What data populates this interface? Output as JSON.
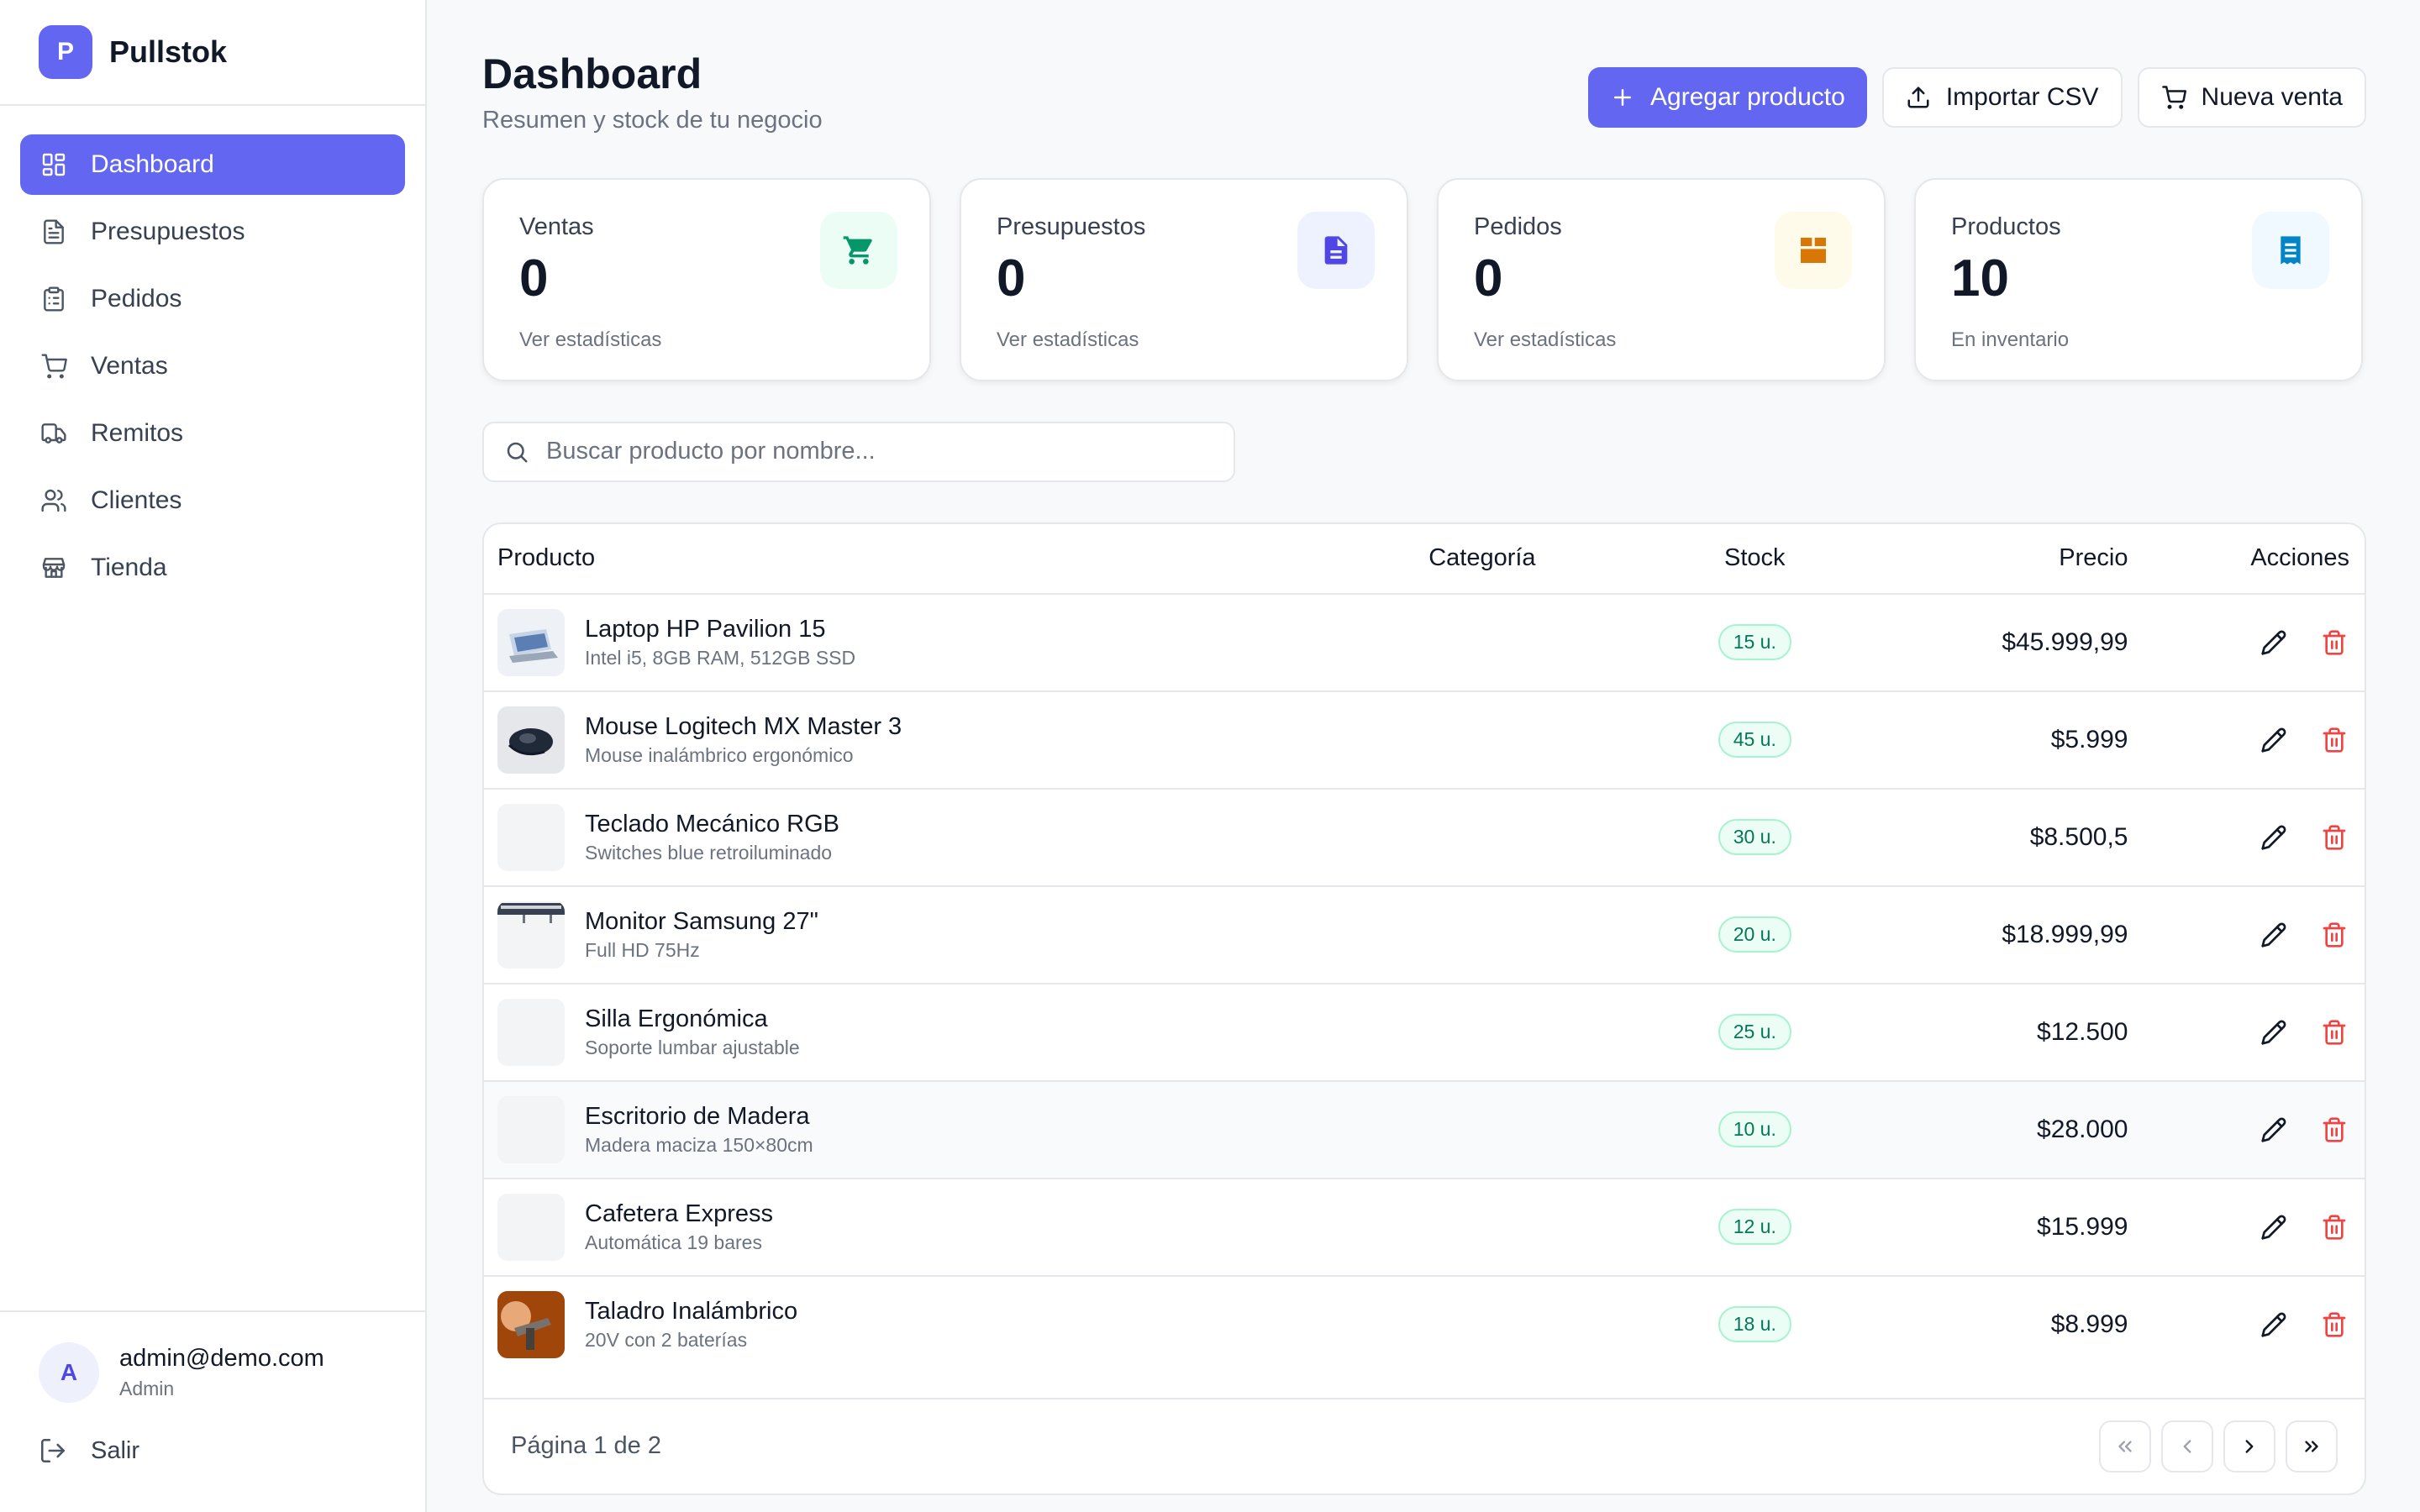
{
  "brand": {
    "logo_letter": "P",
    "name": "Pullstok",
    "accent": "#6366f1"
  },
  "sidebar": {
    "items": [
      {
        "label": "Dashboard",
        "icon": "dashboard-grid-icon",
        "active": true
      },
      {
        "label": "Presupuestos",
        "icon": "document-icon"
      },
      {
        "label": "Pedidos",
        "icon": "clipboard-icon"
      },
      {
        "label": "Ventas",
        "icon": "cart-icon"
      },
      {
        "label": "Remitos",
        "icon": "truck-icon"
      },
      {
        "label": "Clientes",
        "icon": "users-icon"
      },
      {
        "label": "Tienda",
        "icon": "store-icon"
      }
    ],
    "user": {
      "initial": "A",
      "email": "admin@demo.com",
      "role": "Admin"
    },
    "logout_label": "Salir"
  },
  "header": {
    "title": "Dashboard",
    "subtitle": "Resumen y stock de tu negocio",
    "buttons": {
      "add": "Agregar producto",
      "import": "Importar CSV",
      "sale": "Nueva venta"
    }
  },
  "stats": [
    {
      "label": "Ventas",
      "value": "0",
      "sub": "Ver estadísticas",
      "icon": "cart-icon",
      "color": "#059669",
      "bg": "#ecfdf5"
    },
    {
      "label": "Presupuestos",
      "value": "0",
      "sub": "Ver estadísticas",
      "icon": "document-icon",
      "color": "#4f46e5",
      "bg": "#eef2ff"
    },
    {
      "label": "Pedidos",
      "value": "0",
      "sub": "Ver estadísticas",
      "icon": "box-icon",
      "color": "#d97706",
      "bg": "#fffbeb"
    },
    {
      "label": "Productos",
      "value": "10",
      "sub": "En inventario",
      "icon": "receipt-icon",
      "color": "#0284c7",
      "bg": "#f0f9ff"
    }
  ],
  "search": {
    "placeholder": "Buscar producto por nombre..."
  },
  "table": {
    "headers": {
      "product": "Producto",
      "category": "Categoría",
      "stock": "Stock",
      "price": "Precio",
      "actions": "Acciones"
    },
    "rows": [
      {
        "name": "Laptop HP Pavilion 15",
        "desc": "Intel i5, 8GB RAM, 512GB SSD",
        "category": "",
        "stock": "15 u.",
        "price": "$45.999,99",
        "thumb": "laptop"
      },
      {
        "name": "Mouse Logitech MX Master 3",
        "desc": "Mouse inalámbrico ergonómico",
        "category": "",
        "stock": "45 u.",
        "price": "$5.999",
        "thumb": "mouse"
      },
      {
        "name": "Teclado Mecánico RGB",
        "desc": "Switches blue retroiluminado",
        "category": "",
        "stock": "30 u.",
        "price": "$8.500,5",
        "thumb": "none"
      },
      {
        "name": "Monitor Samsung 27\"",
        "desc": "Full HD 75Hz",
        "category": "",
        "stock": "20 u.",
        "price": "$18.999,99",
        "thumb": "monitor"
      },
      {
        "name": "Silla Ergonómica",
        "desc": "Soporte lumbar ajustable",
        "category": "",
        "stock": "25 u.",
        "price": "$12.500",
        "thumb": "none"
      },
      {
        "name": "Escritorio de Madera",
        "desc": "Madera maciza 150×80cm",
        "category": "",
        "stock": "10 u.",
        "price": "$28.000",
        "thumb": "none"
      },
      {
        "name": "Cafetera Express",
        "desc": "Automática 19 bares",
        "category": "",
        "stock": "12 u.",
        "price": "$15.999",
        "thumb": "none"
      },
      {
        "name": "Taladro Inalámbrico",
        "desc": "20V con 2 baterías",
        "category": "",
        "stock": "18 u.",
        "price": "$8.999",
        "thumb": "drill"
      }
    ],
    "pagination": {
      "text": "Página 1 de 2"
    }
  }
}
